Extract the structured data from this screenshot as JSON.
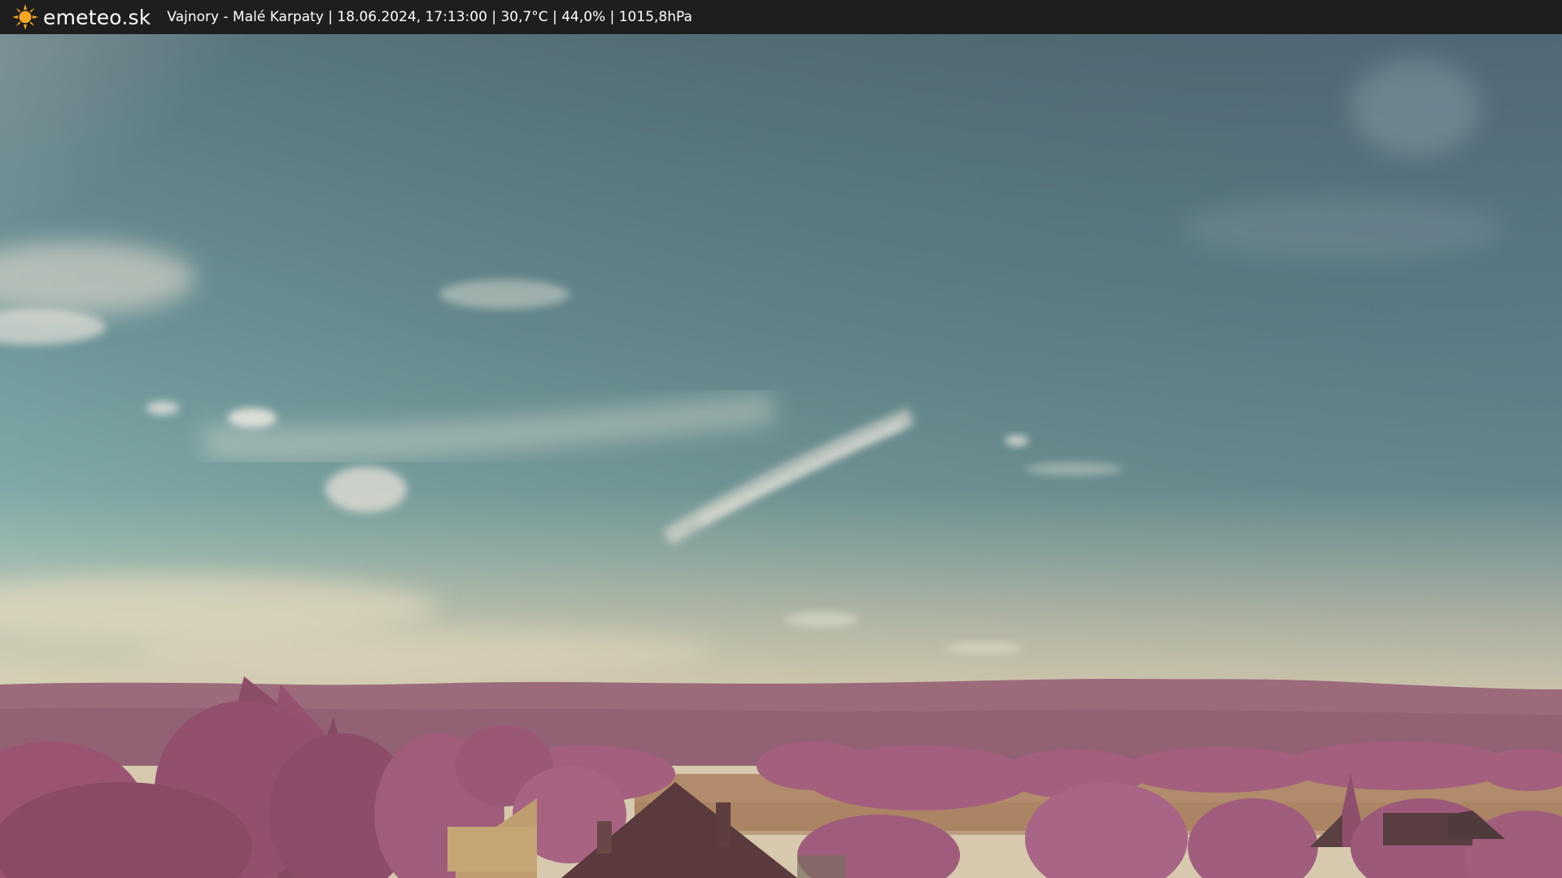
{
  "header": {
    "brand": "emeteo.sk",
    "caption": "Vajnory - Malé Karpaty | 18.06.2024, 17:13:00 | 30,7°C | 44,0% | 1015,8hPa",
    "logo_icon": "sun-icon",
    "logo_color": "#f5a623"
  },
  "scene": {
    "palette": {
      "sky_top": "#5f7e86",
      "sky_mid": "#7aa6a7",
      "sky_horizon": "#d8cdb0",
      "hills": "#9a6a7c",
      "foliage": "#a0607a",
      "field": "#b08a6c",
      "roof": "#5a3b3b"
    }
  }
}
